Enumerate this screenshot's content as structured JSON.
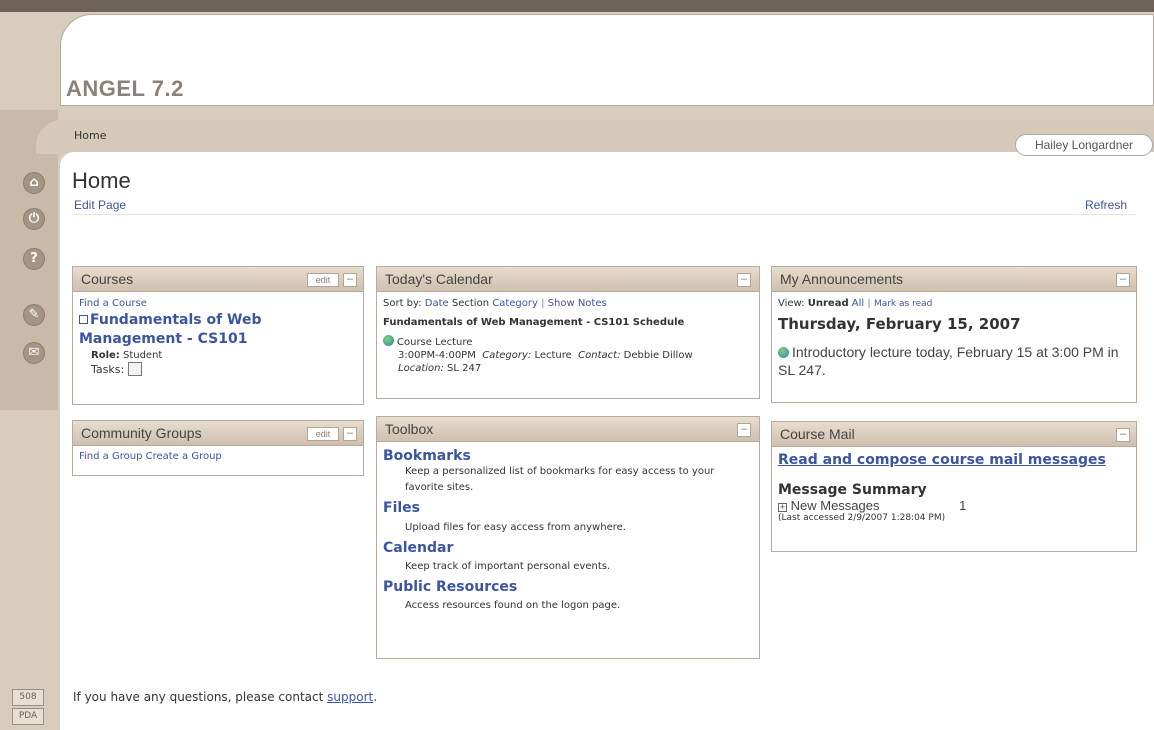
{
  "app_title": "ANGEL 7.2",
  "breadcrumb": "Home",
  "user_name": "Hailey Longardner",
  "page_title": "Home",
  "edit_page_link": "Edit Page",
  "refresh_link": "Refresh",
  "side_icons": [
    "home-icon",
    "power-icon",
    "help-icon",
    "tools-icon",
    "chat-icon"
  ],
  "footer_buttons": [
    "508",
    "PDA"
  ],
  "courses": {
    "title": "Courses",
    "edit_label": "edit",
    "minimize_label": "–",
    "find_course": "Find a Course",
    "course_name": "Fundamentals of Web Management - CS101",
    "role_label": "Role:",
    "role_value": "Student",
    "tasks_label": "Tasks:"
  },
  "community": {
    "title": "Community Groups",
    "edit_label": "edit",
    "minimize_label": "–",
    "find_group": "Find a Group",
    "create_group": "Create a Group"
  },
  "calendar": {
    "title": "Today's Calendar",
    "minimize_label": "–",
    "sort_label": "Sort by:",
    "sort_date": "Date",
    "sort_section": "Section",
    "sort_category": "Category",
    "separator": "|",
    "show_notes": "Show Notes",
    "schedule_title": "Fundamentals of Web Management - CS101 Schedule",
    "event_name": "Course Lecture",
    "event_time": "3:00PM-4:00PM",
    "category_label": "Category:",
    "category_value": "Lecture",
    "contact_label": "Contact:",
    "contact_value": "Debbie Dillow",
    "location_label": "Location:",
    "location_value": "SL 247"
  },
  "toolbox": {
    "title": "Toolbox",
    "minimize_label": "–",
    "items": [
      {
        "name": "Bookmarks",
        "desc": "Keep a personalized list of bookmarks for easy access to your favorite sites."
      },
      {
        "name": "Files",
        "desc": "Upload files for easy access from anywhere."
      },
      {
        "name": "Calendar",
        "desc": "Keep track of important personal events."
      },
      {
        "name": "Public Resources",
        "desc": "Access resources found on the logon page."
      }
    ]
  },
  "announcements": {
    "title": "My Announcements",
    "minimize_label": "–",
    "view_label": "View:",
    "unread": "Unread",
    "all": "All",
    "separator": "|",
    "mark_read": "Mark as read",
    "date": "Thursday, February 15, 2007",
    "text": "Introductory lecture today, February 15 at 3:00 PM in SL 247."
  },
  "course_mail": {
    "title": "Course Mail",
    "minimize_label": "–",
    "compose_link": "Read and compose course mail messages",
    "summary_title": "Message Summary",
    "new_messages_label": "New Messages",
    "new_messages_count": "1",
    "last_accessed": "(Last accessed 2/9/2007 1:28:04 PM)"
  },
  "footer": {
    "text": "If you have any questions, please contact",
    "link": "support",
    "period": "."
  }
}
